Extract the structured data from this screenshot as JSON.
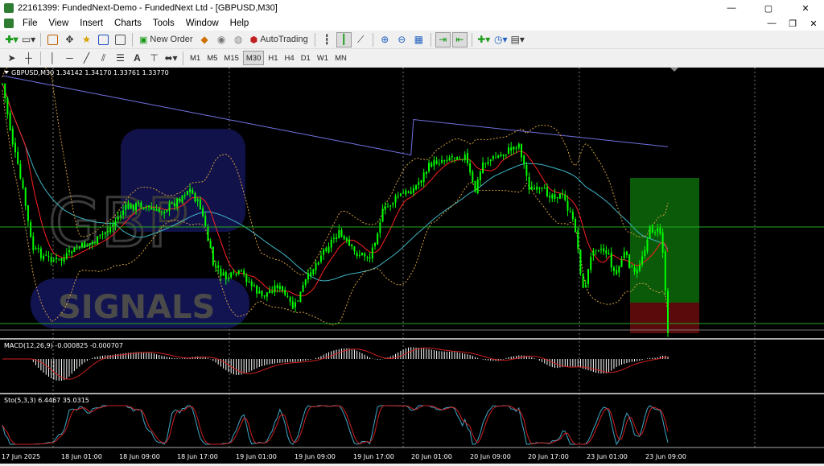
{
  "window": {
    "title": "22161399: FundedNext-Demo - FundedNext Ltd - [GBPUSD,M30]",
    "controls": [
      "—",
      "▢",
      "✕"
    ]
  },
  "menu": {
    "items": [
      "File",
      "View",
      "Insert",
      "Charts",
      "Tools",
      "Window",
      "Help"
    ],
    "controls": [
      "—",
      "❐",
      "✕"
    ]
  },
  "toolbar": {
    "new_order": "New Order",
    "autotrading": "AutoTrading"
  },
  "timeframes": [
    "M1",
    "M5",
    "M15",
    "M30",
    "H1",
    "H4",
    "D1",
    "W1",
    "MN"
  ],
  "active_timeframe": "M30",
  "chart": {
    "header": "GBPUSD,M30  1.34142 1.34170 1.33761 1.33770",
    "watermark_top": "GBP",
    "watermark_bottom": "SIGNALS",
    "macd_label": "MACD(12,26,9) -0.000825 -0.000707",
    "sto_label": "Sto(5,3,3) 6.4467 35.0315",
    "time_labels": [
      "17 Jun 2025",
      "18 Jun 01:00",
      "18 Jun 09:00",
      "18 Jun 17:00",
      "19 Jun 01:00",
      "19 Jun 09:00",
      "19 Jun 17:00",
      "20 Jun 01:00",
      "20 Jun 09:00",
      "20 Jun 17:00",
      "23 Jun 01:00",
      "23 Jun 09:00"
    ]
  },
  "chart_data": {
    "type": "line",
    "title": "GBPUSD,M30",
    "ohlc_last": {
      "open": 1.34142,
      "high": 1.3417,
      "low": 1.33761,
      "close": 1.3377
    },
    "x": [
      "17 Jun 2025",
      "18 Jun 01:00",
      "18 Jun 09:00",
      "18 Jun 17:00",
      "19 Jun 01:00",
      "19 Jun 09:00",
      "19 Jun 17:00",
      "20 Jun 01:00",
      "20 Jun 09:00",
      "20 Jun 17:00",
      "23 Jun 01:00",
      "23 Jun 09:00"
    ],
    "series": [
      {
        "name": "MACD(12,26,9)",
        "values": [
          -0.000825,
          -0.000707
        ]
      },
      {
        "name": "Sto(5,3,3)",
        "values": [
          6.4467,
          35.0315
        ]
      }
    ],
    "colors": {
      "price": "#00ff00",
      "ma_fast": "#ff2020",
      "ma_mid": "#3fb6c6",
      "ma_slow": "#7070e0",
      "bands": "#d2a040",
      "tp_zone": "#0a5a0a",
      "sl_zone": "#5a0a0a"
    }
  }
}
